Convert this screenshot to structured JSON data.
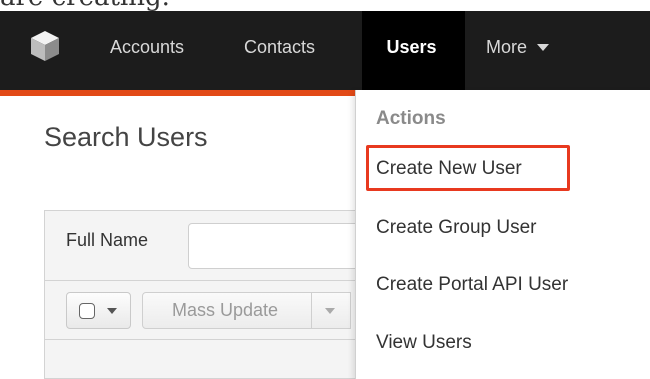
{
  "caption": "are creating.",
  "nav": {
    "logo_icon": "cube-icon",
    "items": [
      {
        "label": "Accounts"
      },
      {
        "label": "Contacts"
      },
      {
        "label": "Users",
        "active": true
      },
      {
        "label": "More"
      }
    ],
    "accent_color": "#e24a17"
  },
  "page": {
    "title": "Search Users"
  },
  "filter": {
    "full_name_label": "Full Name",
    "full_name_value": ""
  },
  "actions": {
    "mass_update_label": "Mass Update"
  },
  "dropdown": {
    "header": "Actions",
    "items": [
      {
        "label": "Create New User",
        "highlighted": true
      },
      {
        "label": "Create Group User"
      },
      {
        "label": "Create Portal API User"
      },
      {
        "label": "View Users"
      }
    ],
    "highlight_color": "#e8391f"
  }
}
